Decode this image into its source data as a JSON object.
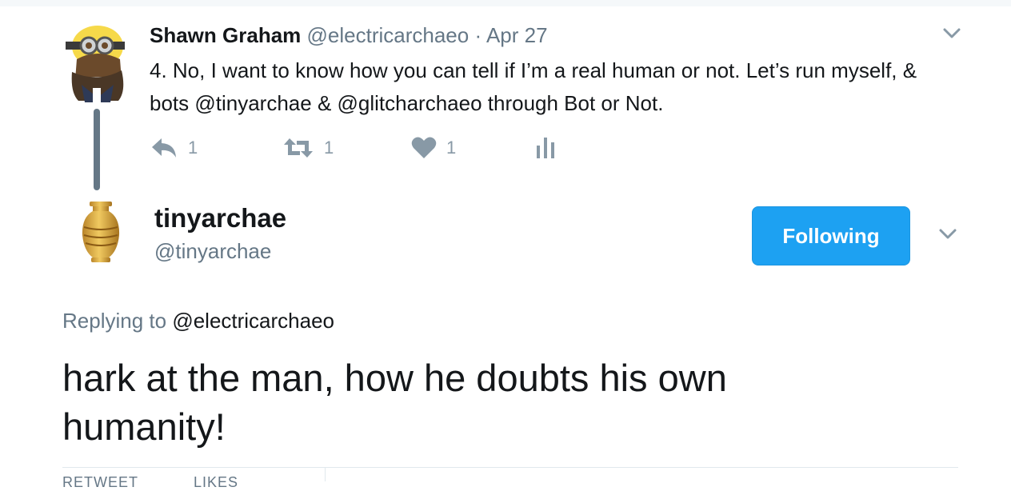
{
  "parent_tweet": {
    "name": "Shawn Graham",
    "handle": "@electricarchaeo",
    "separator": "·",
    "date": "Apr 27",
    "text": "4. No, I want to know how you can tell if I’m a real human or not. Let’s run myself, & bots @tinyarchae & @glitcharchaeo through Bot or Not.",
    "actions": {
      "reply_count": "1",
      "retweet_count": "1",
      "like_count": "1"
    }
  },
  "main_tweet": {
    "name": "tinyarchae",
    "handle": "@tinyarchae",
    "follow_label": "Following",
    "replying_prefix": "Replying to",
    "replying_handle": "@electricarchaeo",
    "text": "hark at the man, how he doubts his own humanity!",
    "stats_labels": [
      "RETWEET",
      "LIKES"
    ]
  },
  "colors": {
    "accent": "#1da1f2",
    "secondary_text": "#657786",
    "icon": "#8899a6"
  },
  "icons": {
    "reply": "reply-icon",
    "retweet": "retweet-icon",
    "like": "heart-icon",
    "analytics": "analytics-icon",
    "menu": "chevron-down-icon"
  }
}
